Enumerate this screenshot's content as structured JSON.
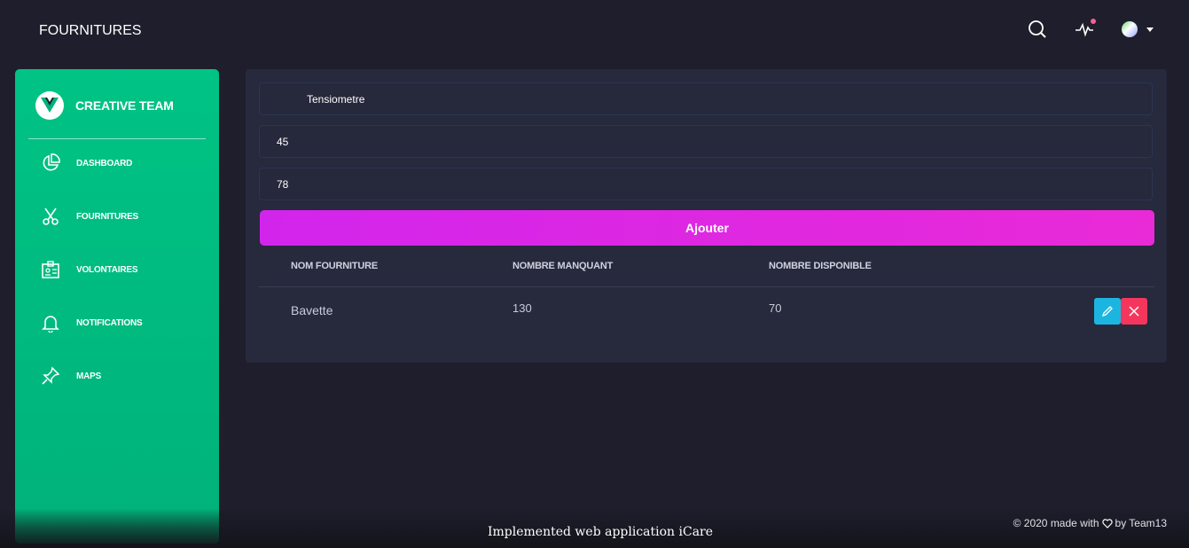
{
  "header": {
    "title": "FOURNITURES"
  },
  "sidebar": {
    "brand": "CREATIVE TEAM",
    "items": [
      {
        "label": "DASHBOARD",
        "icon": "chart-pie-icon"
      },
      {
        "label": "FOURNITURES",
        "icon": "scissors-icon"
      },
      {
        "label": "VOLONTAIRES",
        "icon": "badge-icon"
      },
      {
        "label": "NOTIFICATIONS",
        "icon": "bell-icon"
      },
      {
        "label": "MAPS",
        "icon": "pin-icon"
      }
    ]
  },
  "form": {
    "name_value": "Tensiometre",
    "missing_value": "45",
    "available_value": "78",
    "submit_label": "Ajouter"
  },
  "table": {
    "headers": [
      "NOM FOURNITURE",
      "NOMBRE MANQUANT",
      "NOMBRE DISPONIBLE"
    ],
    "rows": [
      {
        "name": "Bavette",
        "missing": "130",
        "available": "70"
      }
    ]
  },
  "footer": {
    "center_text": "Implemented web application iCare",
    "copyright_prefix": "© 2020 made with",
    "copyright_suffix": "by Team13"
  },
  "colors": {
    "background": "#1e1e2c",
    "card": "#27293d",
    "sidebar": "#00c384",
    "primary": "#e14eca",
    "info": "#1d8cf8",
    "danger": "#fd5d93"
  }
}
